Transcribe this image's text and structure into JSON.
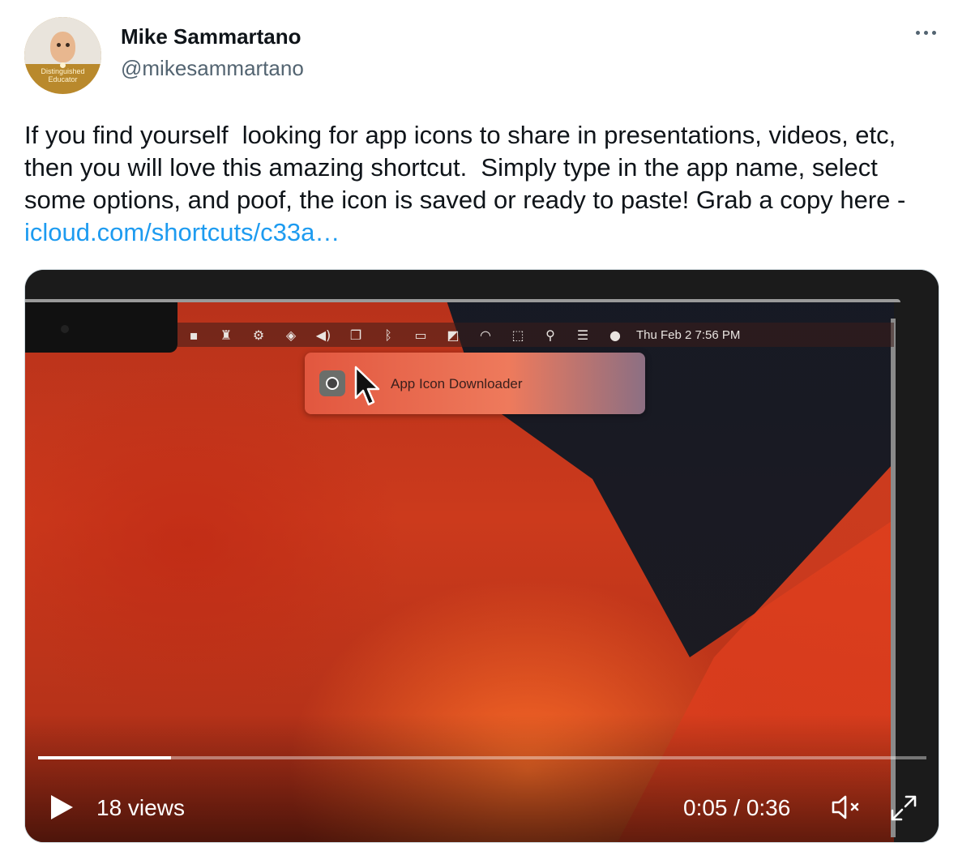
{
  "author": {
    "name": "Mike Sammartano",
    "handle": "@mikesammartano",
    "badge_line1": "Distinguished",
    "badge_line2": "Educator"
  },
  "tweet": {
    "text": "If you find yourself  looking for app icons to share in presentations, videos, etc, then you will love this amazing shortcut.  Simply type in the app name, select some options, and poof, the icon is saved or ready to paste! Grab a copy here -",
    "link_text": "icloud.com/shortcuts/c33a…"
  },
  "video": {
    "menubar_clock": "Thu Feb 2  7:56 PM",
    "popup_label": "App Icon Downloader",
    "progress_fraction": 0.15,
    "views": "18 views",
    "time": "0:05 / 0:36"
  },
  "icons": {
    "more": "more-icon",
    "play": "play-icon",
    "mute": "muted-speaker-icon",
    "fullscreen": "expand-icon"
  }
}
